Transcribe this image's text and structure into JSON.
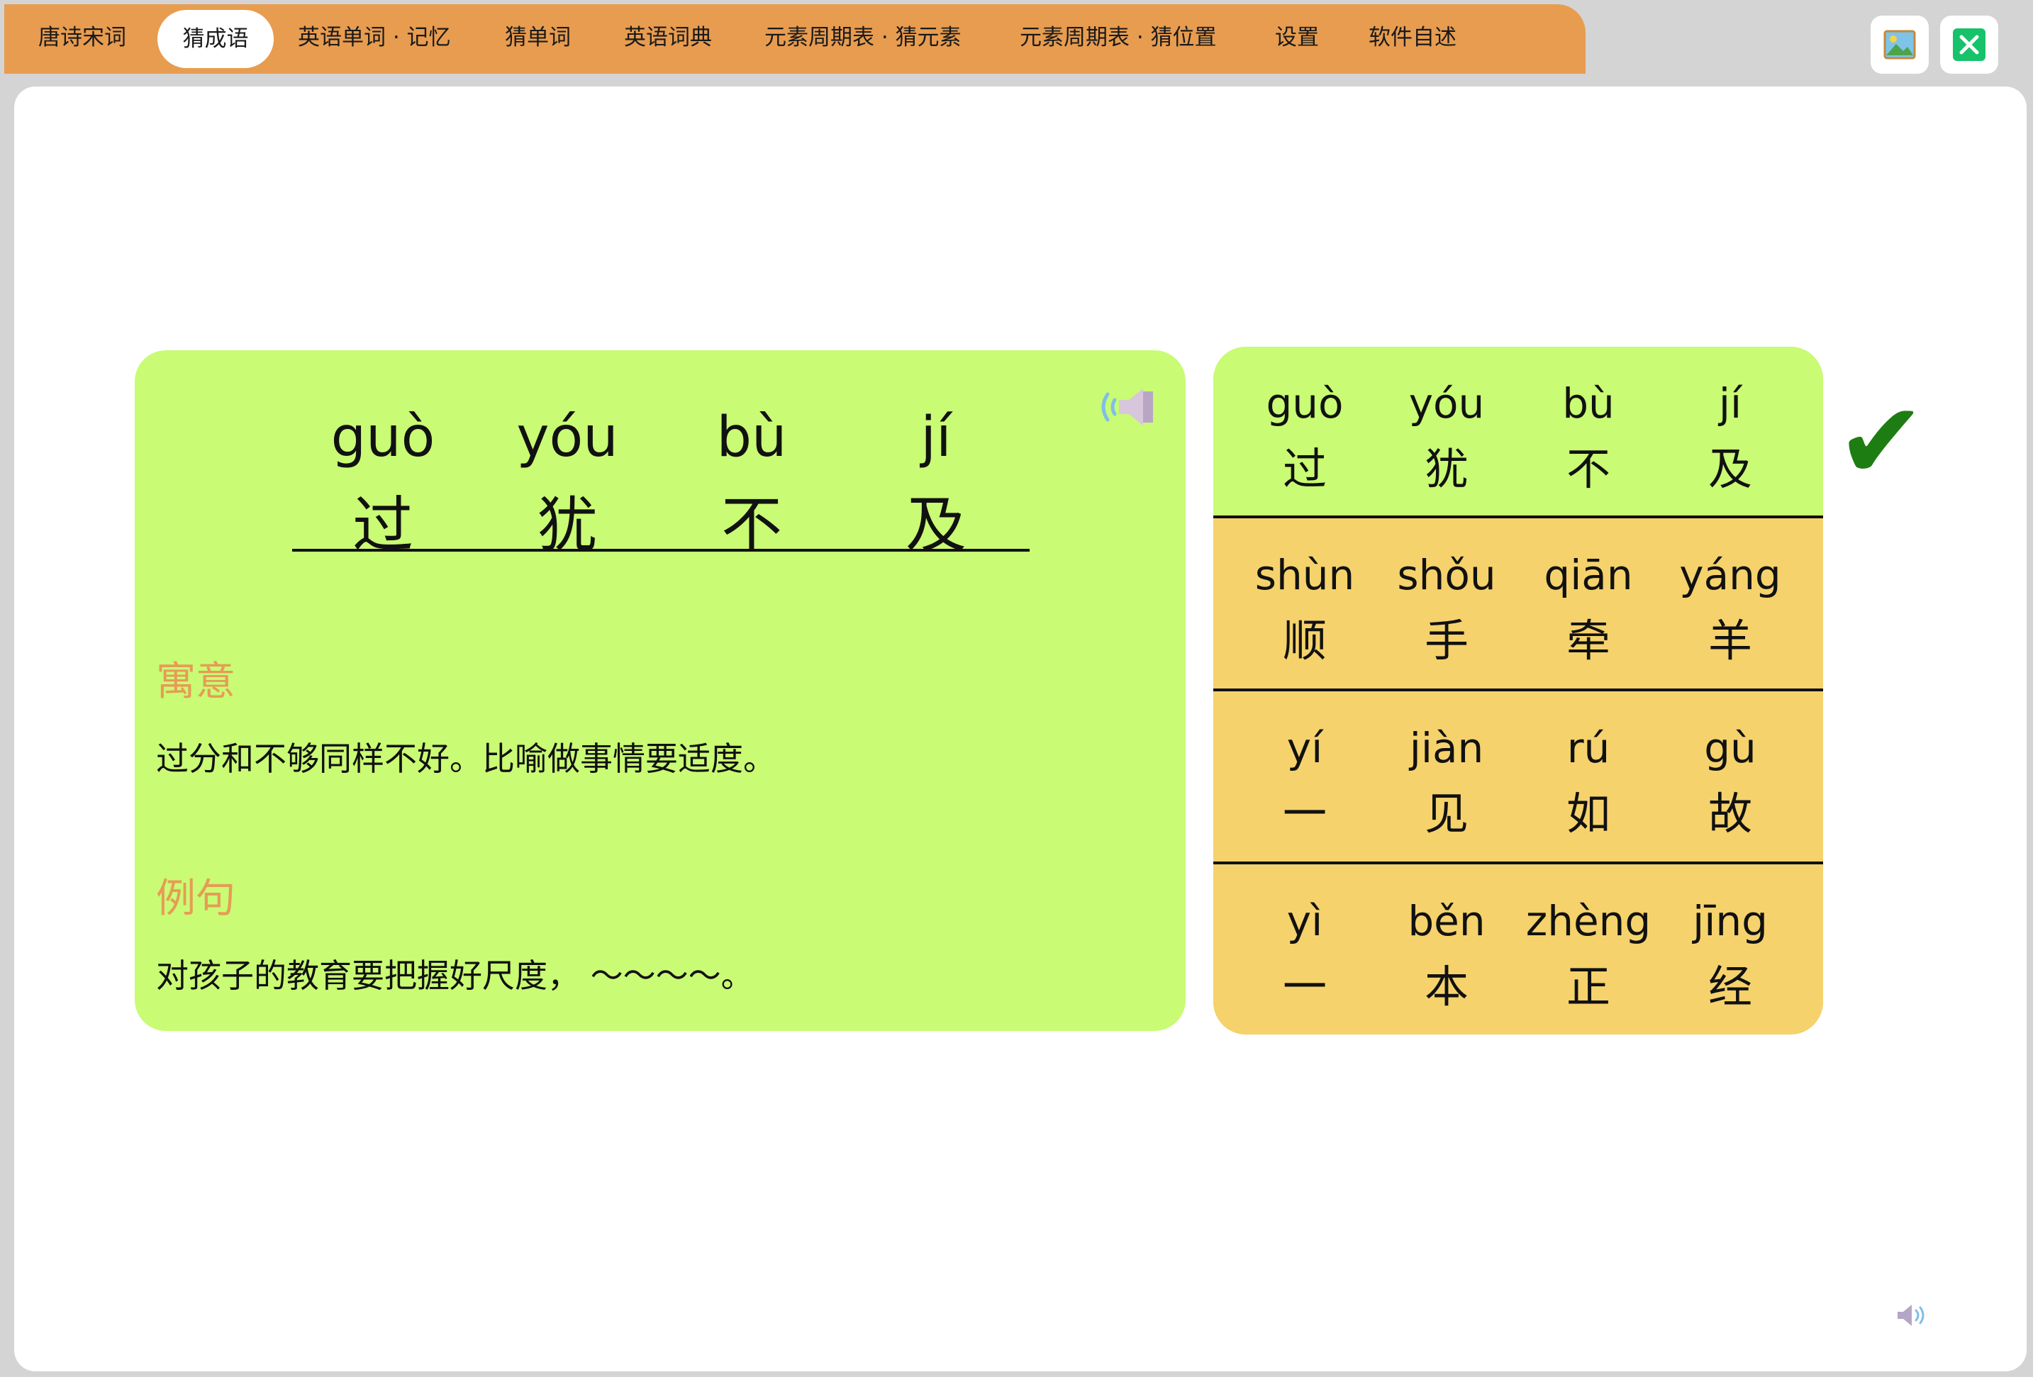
{
  "tabs": [
    "唐诗宋词",
    "猜成语",
    "英语单词 · 记忆",
    "猜单词",
    "英语词典",
    "元素周期表 · 猜元素",
    "元素周期表 · 猜位置",
    "设置",
    "软件自述"
  ],
  "active_tab": "猜成语",
  "window_buttons": {
    "image": "image-icon",
    "close": "close-icon"
  },
  "idiom": {
    "chars": [
      {
        "pinyin": "guò",
        "hanzi": "过"
      },
      {
        "pinyin": "yóu",
        "hanzi": "犹"
      },
      {
        "pinyin": "bù",
        "hanzi": "不"
      },
      {
        "pinyin": "jí",
        "hanzi": "及"
      }
    ],
    "meaning_title": "寓意",
    "meaning": "过分和不够同样不好。比喻做事情要适度。",
    "example_title": "例句",
    "example": "对孩子的教育要把握好尺度， ～～～～。"
  },
  "choices": [
    {
      "correct": true,
      "chars": [
        {
          "pinyin": "guò",
          "hanzi": "过"
        },
        {
          "pinyin": "yóu",
          "hanzi": "犹"
        },
        {
          "pinyin": "bù",
          "hanzi": "不"
        },
        {
          "pinyin": "jí",
          "hanzi": "及"
        }
      ]
    },
    {
      "correct": false,
      "chars": [
        {
          "pinyin": "shùn",
          "hanzi": "顺"
        },
        {
          "pinyin": "shǒu",
          "hanzi": "手"
        },
        {
          "pinyin": "qiān",
          "hanzi": "牵"
        },
        {
          "pinyin": "yáng",
          "hanzi": "羊"
        }
      ]
    },
    {
      "correct": false,
      "chars": [
        {
          "pinyin": "yí",
          "hanzi": "一"
        },
        {
          "pinyin": "jiàn",
          "hanzi": "见"
        },
        {
          "pinyin": "rú",
          "hanzi": "如"
        },
        {
          "pinyin": "gù",
          "hanzi": "故"
        }
      ]
    },
    {
      "correct": false,
      "chars": [
        {
          "pinyin": "yì",
          "hanzi": "一"
        },
        {
          "pinyin": "běn",
          "hanzi": "本"
        },
        {
          "pinyin": "zhèng",
          "hanzi": "正"
        },
        {
          "pinyin": "jīng",
          "hanzi": "经"
        }
      ]
    }
  ],
  "check_mark": "✔",
  "colors": {
    "tabbar": "#e89c4f",
    "card": "#c9fb74",
    "choice": "#f5d26c",
    "accent": "#e79b55",
    "check": "#1e7d12"
  }
}
